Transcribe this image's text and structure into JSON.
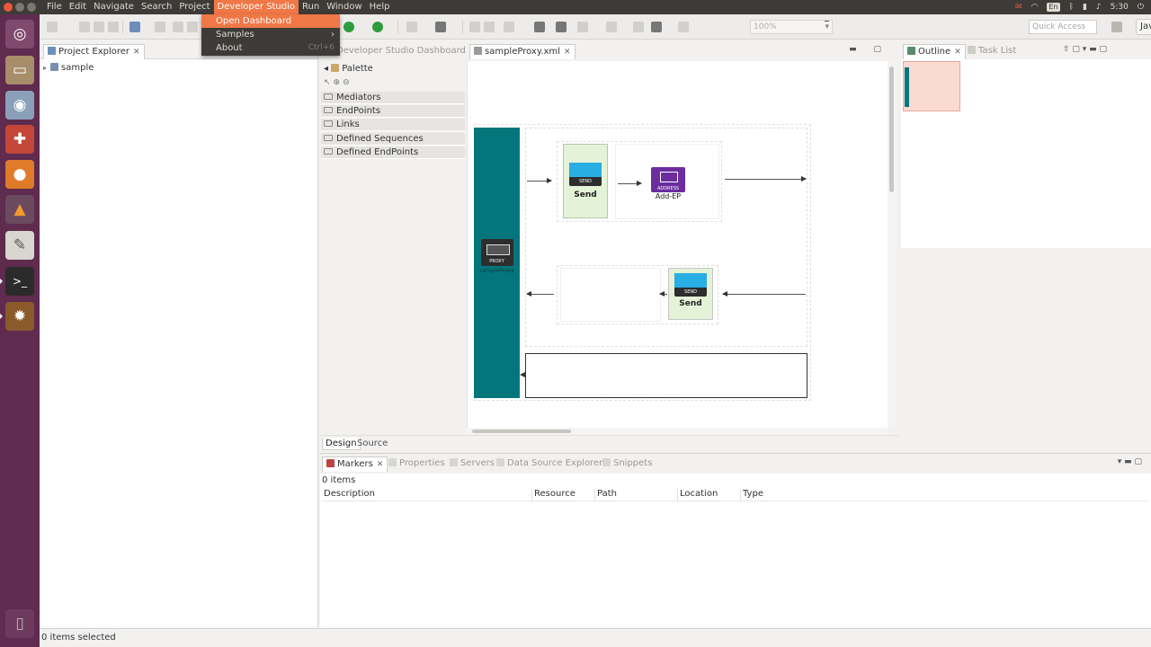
{
  "menubar": {
    "items": [
      "File",
      "Edit",
      "Navigate",
      "Search",
      "Project",
      "Developer Studio",
      "Run",
      "Window",
      "Help"
    ],
    "active": "Developer Studio"
  },
  "tray": {
    "keyboard": "En",
    "time": "5:30"
  },
  "dev_menu": {
    "open_dashboard": "Open Dashboard",
    "samples": "Samples",
    "about": "About",
    "about_shortcut": "Ctrl+6"
  },
  "toolbar": {
    "zoom": "100%",
    "quick_access_placeholder": "Quick Access",
    "perspective": "Java EE"
  },
  "explorer": {
    "tab_label": "Project Explorer",
    "project": "sample"
  },
  "editor": {
    "tabs": [
      "Developer Studio Dashboard",
      "sampleProxy.xml"
    ],
    "active_tab": "sampleProxy.xml",
    "palette_title": "Palette",
    "palette_drawers": [
      "Mediators",
      "EndPoints",
      "Links",
      "Defined Sequences",
      "Defined EndPoints"
    ],
    "mode_tabs": [
      "Design",
      "Source"
    ]
  },
  "diagram": {
    "proxy_badge": "PROXY",
    "proxy_name": "sampleProxy",
    "in_mediator_badge": "SEND",
    "in_mediator_label": "Send",
    "endpoint_badge": "ADDRESS",
    "endpoint_label": "Add-EP",
    "out_mediator_badge": "SEND",
    "out_mediator_label": "Send"
  },
  "outline": {
    "tabs": [
      "Outline",
      "Task List"
    ]
  },
  "markers": {
    "tabs": [
      "Markers",
      "Properties",
      "Servers",
      "Data Source Explorer",
      "Snippets"
    ],
    "count": "0 items",
    "columns": [
      "Description",
      "Resource",
      "Path",
      "Location",
      "Type"
    ]
  },
  "status": {
    "text": "0 items selected"
  },
  "colors": {
    "ubuntu_accent": "#f07746",
    "launcher_bg": "#5f2b4e",
    "proxy_teal": "#03767c",
    "endpoint_purple": "#6c2d9e"
  }
}
